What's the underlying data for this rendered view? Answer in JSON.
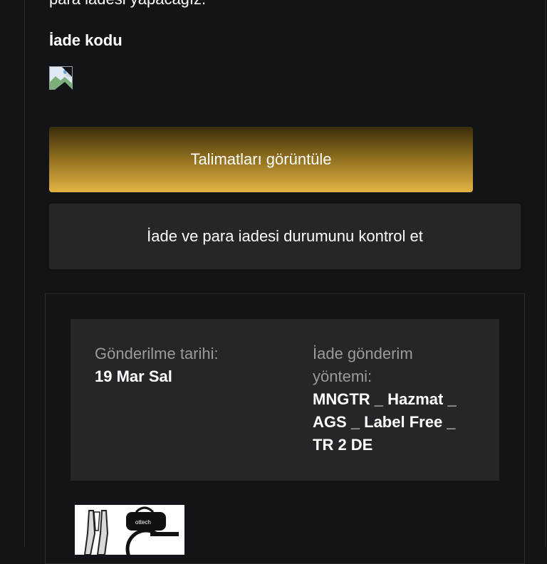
{
  "intro_text": "para iadesi yapacağız.",
  "return_code": {
    "title": "İade kodu"
  },
  "buttons": {
    "view_instructions": "Talimatları görüntüle",
    "check_status": "İade ve para iadesi durumunu kontrol et"
  },
  "shipment": {
    "sent_date_label": "Gönderilme tarihi:",
    "sent_date_value": "19 Mar Sal",
    "method_label_line1": "İade gönderim",
    "method_label_line2": "yöntemi:",
    "method_value_line1": "MNGTR _ Hazmat _",
    "method_value_line2": "AGS _ Label Free _",
    "method_value_line3": "TR 2 DE"
  },
  "product": {
    "thumb_text": "ottech"
  },
  "colors": {
    "background": "#131418",
    "primary_gold": "#e3b443",
    "secondary_button": "#25262a",
    "label_gray": "#9a9b9f"
  }
}
